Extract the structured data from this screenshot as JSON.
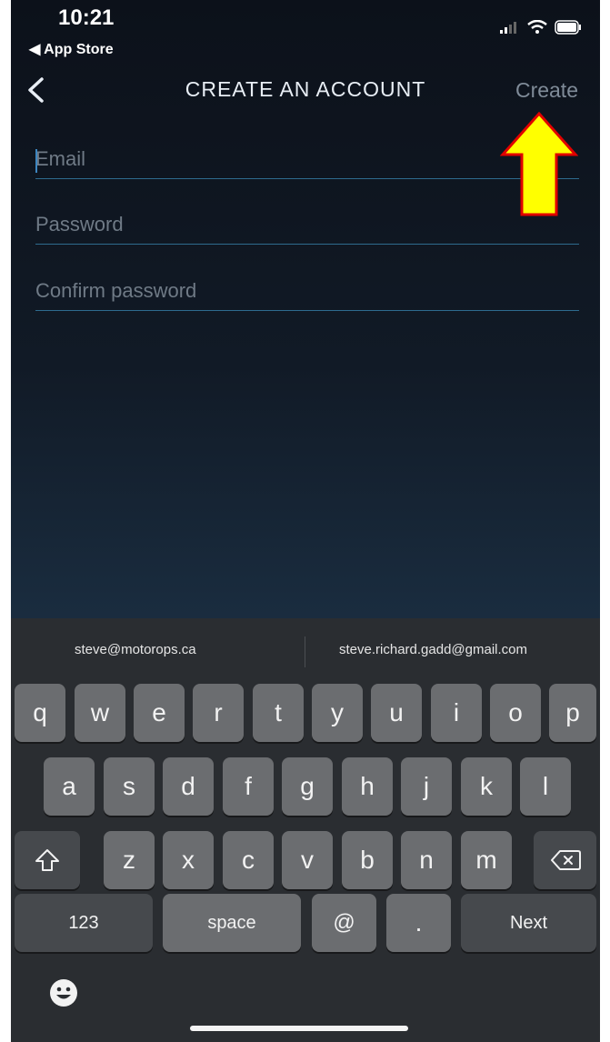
{
  "status_bar": {
    "time": "10:21",
    "back_label": "◀ App Store"
  },
  "nav": {
    "title": "CREATE AN ACCOUNT",
    "create_label": "Create"
  },
  "form": {
    "email_placeholder": "Email",
    "password_placeholder": "Password",
    "confirm_placeholder": "Confirm password"
  },
  "keyboard": {
    "suggestions": [
      "steve@motorops.ca",
      "steve.richard.gadd@gmail.com"
    ],
    "row1": [
      "q",
      "w",
      "e",
      "r",
      "t",
      "y",
      "u",
      "i",
      "o",
      "p"
    ],
    "row2": [
      "a",
      "s",
      "d",
      "f",
      "g",
      "h",
      "j",
      "k",
      "l"
    ],
    "row3": [
      "z",
      "x",
      "c",
      "v",
      "b",
      "n",
      "m"
    ],
    "numbers_label": "123",
    "space_label": "space",
    "at_label": "@",
    "dot_label": ".",
    "next_label": "Next"
  },
  "colors": {
    "background_top": "#0c111a",
    "background_bottom": "#23384e",
    "field_underline": "#2e6b8e",
    "annotation_arrow": "#ffff00",
    "arrow_outline": "#e00000"
  }
}
